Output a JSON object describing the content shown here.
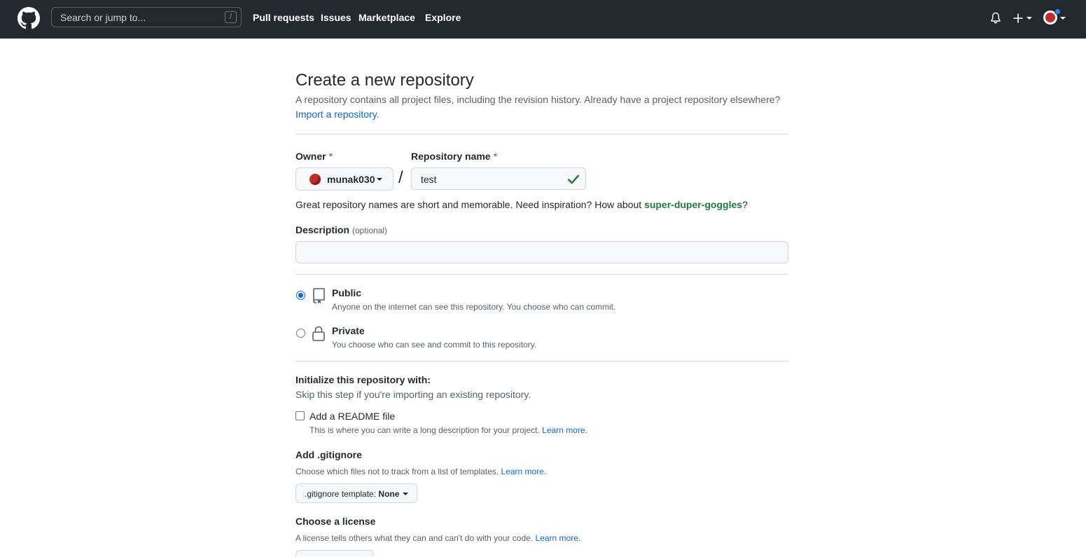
{
  "header": {
    "search_placeholder": "Search or jump to...",
    "search_shortcut": "/",
    "nav": [
      "Pull requests",
      "Issues",
      "Marketplace",
      "Explore"
    ],
    "icons": [
      "github-logo-icon",
      "bell-icon",
      "plus-icon",
      "avatar"
    ]
  },
  "page": {
    "title": "Create a new repository",
    "subtitle": "A repository contains all project files, including the revision history. Already have a project repository elsewhere?",
    "import_link": "Import a repository."
  },
  "owner": {
    "label": "Owner",
    "required": "*",
    "value": "munak030"
  },
  "repo_name": {
    "label": "Repository name",
    "required": "*",
    "value": "test",
    "status": "valid"
  },
  "name_hint": {
    "prefix": "Great repository names are short and memorable. Need inspiration? How about ",
    "suggestion": "super-duper-goggles",
    "suffix": "?"
  },
  "description": {
    "label": "Description",
    "optional": "(optional)",
    "value": ""
  },
  "visibility": {
    "selected": "Public",
    "public": {
      "title": "Public",
      "desc": "Anyone on the internet can see this repository. You choose who can commit."
    },
    "private": {
      "title": "Private",
      "desc": "You choose who can see and commit to this repository."
    }
  },
  "init": {
    "title": "Initialize this repository with:",
    "desc": "Skip this step if you're importing an existing repository.",
    "readme_label": "Add a README file",
    "readme_checked": false,
    "readme_desc": "This is where you can write a long description for your project.",
    "readme_link": "Learn more."
  },
  "gitignore": {
    "title": "Add .gitignore",
    "desc": "Choose which files not to track from a list of templates.",
    "link": "Learn more.",
    "select_label": ".gitignore template:",
    "select_value": "None"
  },
  "license": {
    "title": "Choose a license",
    "desc": "A license tells others what they can and can't do with your code.",
    "link": "Learn more."
  },
  "colors": {
    "header_bg": "#24292f",
    "link": "#0969da",
    "success": "#1a7f37",
    "required": "#cf222e"
  }
}
